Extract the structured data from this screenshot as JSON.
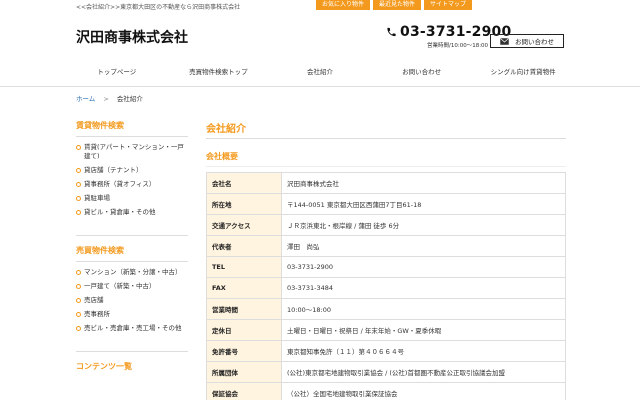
{
  "header": {
    "tagline": "<<会社紹介>>東京都大田区の不動産なら沢田商事株式会社",
    "top_links": [
      "お気に入り物件",
      "最近見た物件",
      "サイトマップ"
    ],
    "logo": "沢田商事株式会社",
    "phone": "03-3731-2900",
    "hours": "営業時間/10:00〜18:00",
    "contact_button": "お問い合わせ",
    "colors": {
      "accent": "#f39a1e",
      "link": "#2b6fb6",
      "table_header_bg": "#fff4e0"
    }
  },
  "nav": [
    "トップページ",
    "売買物件検索トップ",
    "会社紹介",
    "お問い合わせ",
    "シングル向け賃貸物件"
  ],
  "breadcrumb": {
    "home": "ホーム",
    "separator": ">",
    "current": "会社紹介"
  },
  "sidebar": {
    "rental_title": "賃貸物件検索",
    "rental_items": [
      "賃貸(アパート・マンション・一戸建て)",
      "貸店舗（テナント）",
      "貸事務所（貸オフィス）",
      "貸駐車場",
      "貸ビル・貸倉庫・その他"
    ],
    "sale_title": "売買物件検索",
    "sale_items": [
      "マンション（新築・分譲・中古）",
      "一戸建て（新築・中古）",
      "売店舗",
      "売事務所",
      "売ビル・売倉庫・売工場・その他"
    ],
    "contents_title": "コンテンツ一覧"
  },
  "main": {
    "page_title": "会社紹介",
    "section_title": "会社概要",
    "rows": [
      {
        "label": "会社名",
        "value": "沢田商事株式会社"
      },
      {
        "label": "所在地",
        "value": "〒144-0051 東京都大田区西蒲田7丁目61-18"
      },
      {
        "label": "交通アクセス",
        "value": "ＪＲ京浜東北・根岸線 / 蒲田 徒歩 6分"
      },
      {
        "label": "代表者",
        "value": "澤田　尚弘"
      },
      {
        "label": "TEL",
        "value": "03-3731-2900"
      },
      {
        "label": "FAX",
        "value": "03-3731-3484"
      },
      {
        "label": "営業時間",
        "value": "10:00〜18:00"
      },
      {
        "label": "定休日",
        "value": "土曜日・日曜日・祝祭日 / 年末年始・GW・夏季休暇"
      },
      {
        "label": "免許番号",
        "value": "東京都知事免許（１１）第４０６６４号"
      },
      {
        "label": "所属団体",
        "value": "(公社)東京都宅地建物取引業協会 / (公社)首都圏不動産公正取引協議会加盟"
      },
      {
        "label": "保証協会",
        "value": "（公社）全国宅地建物取引業保証協会"
      }
    ]
  }
}
